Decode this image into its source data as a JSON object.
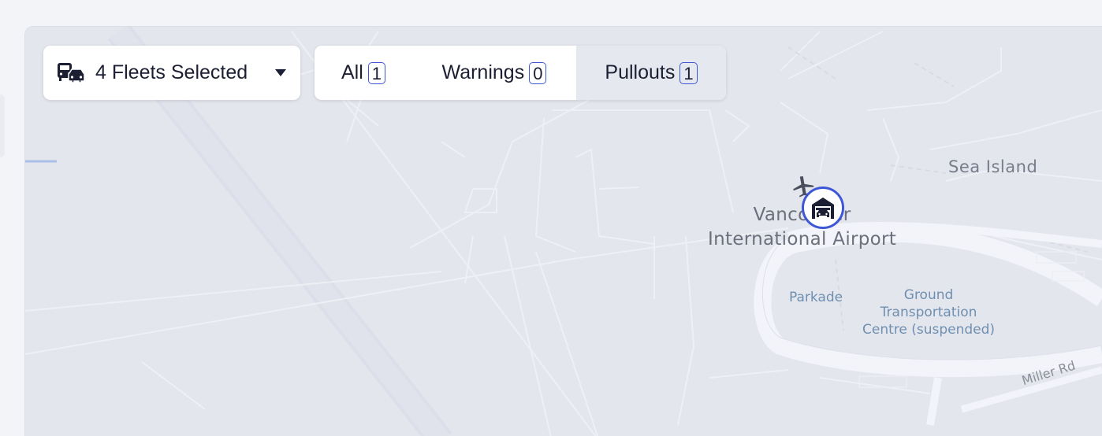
{
  "fleet_selector": {
    "label": "4 Fleets Selected",
    "icon": "bus-car-icon"
  },
  "filters": {
    "tabs": [
      {
        "label": "All",
        "count": "1"
      },
      {
        "label": "Warnings",
        "count": "0"
      },
      {
        "label": "Pullouts",
        "count": "1",
        "selected": true
      }
    ]
  },
  "map": {
    "labels": {
      "sea_island": "Sea Island",
      "airport_line1": "Vancouver",
      "airport_line2": "International Airport",
      "parkade": "Parkade",
      "gtc_line1": "Ground",
      "gtc_line2": "Transportation",
      "gtc_line3": "Centre (suspended)",
      "miller_rd": "Miller Rd"
    },
    "markers": [
      {
        "type": "pullout",
        "icon": "garage-car-icon",
        "accent": "#3d57d6"
      },
      {
        "type": "airport",
        "icon": "airplane-icon"
      }
    ]
  },
  "colors": {
    "accent": "#3d57d6",
    "map_background": "#e4e6ee",
    "road": "#f0f1f7",
    "text_dark": "#1c1f33"
  }
}
